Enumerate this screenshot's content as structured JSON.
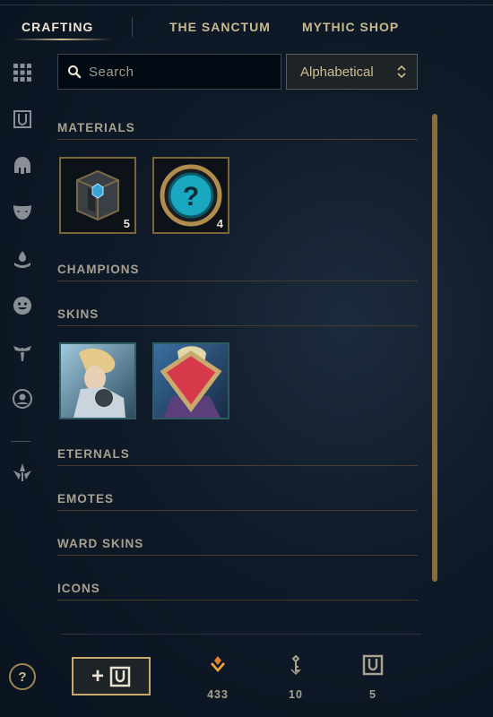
{
  "nav": {
    "tabs": [
      {
        "label": "CRAFTING",
        "active": true
      },
      {
        "label": "THE SANCTUM",
        "active": false
      },
      {
        "label": "MYTHIC SHOP",
        "active": false
      }
    ]
  },
  "rail": {
    "items": [
      "grid-icon",
      "chest-icon",
      "helmet-icon",
      "mask-icon",
      "ward-icon",
      "emote-icon",
      "eternals-icon",
      "profile-icon",
      "filter-icon"
    ]
  },
  "search": {
    "placeholder": "Search",
    "value": ""
  },
  "sort": {
    "selected": "Alphabetical"
  },
  "sections": {
    "materials": "MATERIALS",
    "champions": "CHAMPIONS",
    "skins": "SKINS",
    "eternals": "ETERNALS",
    "emotes": "EMOTES",
    "ward_skins": "WARD SKINS",
    "icons": "ICONS"
  },
  "materials": [
    {
      "name": "hextech-chest",
      "count": "5"
    },
    {
      "name": "mystery-orb",
      "count": "4"
    }
  ],
  "skins": [
    {
      "name": "skin-shard-1"
    },
    {
      "name": "skin-shard-2"
    }
  ],
  "footer": {
    "help": "?",
    "add_plus": "+",
    "currencies": [
      {
        "name": "orange-essence",
        "amount": "433"
      },
      {
        "name": "key",
        "amount": "10"
      },
      {
        "name": "chest",
        "amount": "5"
      }
    ]
  },
  "colors": {
    "gold": "#c8aa6e",
    "accent": "#0ac8b9",
    "background": "#0f1a28"
  }
}
